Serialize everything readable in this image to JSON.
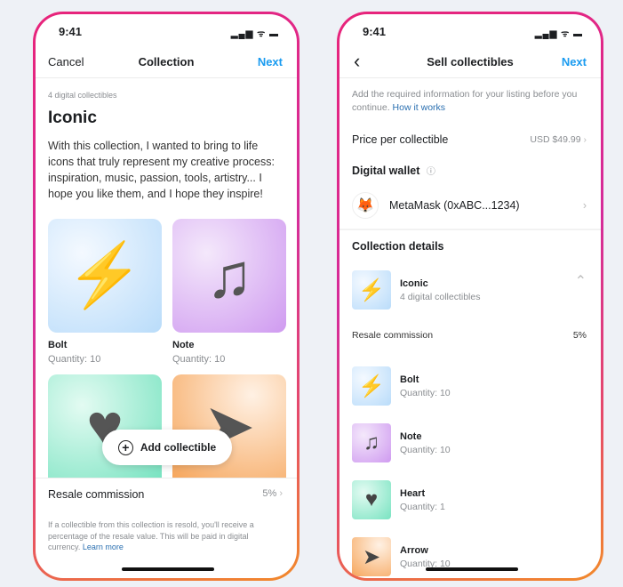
{
  "status": {
    "time": "9:41",
    "icons": "signal-wifi-battery"
  },
  "left": {
    "nav": {
      "cancel": "Cancel",
      "title": "Collection",
      "next": "Next"
    },
    "count": "4 digital collectibles",
    "name": "Iconic",
    "description": "With this collection, I wanted to bring to life icons that truly represent my creative process: inspiration, music, passion, tools, artistry... I hope you like them, and I hope they inspire!",
    "items": [
      {
        "name": "Bolt",
        "qty": "Quantity: 10",
        "icon": "⚡"
      },
      {
        "name": "Note",
        "qty": "Quantity: 10",
        "icon": "♫"
      },
      {
        "icon": "♥"
      },
      {
        "icon": "➤"
      }
    ],
    "add_button": "Add collectible",
    "resale": {
      "label": "Resale commission",
      "value": "5%"
    },
    "footnote": "If a collectible from this collection is resold, you'll receive a percentage of the resale value. This will be paid in digital currency.",
    "learn_more": "Learn more"
  },
  "right": {
    "nav": {
      "title": "Sell collectibles",
      "next": "Next"
    },
    "intro": "Add the required information for your listing before you continue.",
    "how_it_works": "How it works",
    "price": {
      "label": "Price per collectible",
      "value": "USD $49.99"
    },
    "wallet_heading": "Digital wallet",
    "wallet": "MetaMask (0xABC...1234)",
    "details_heading": "Collection details",
    "collection": {
      "name": "Iconic",
      "count": "4 digital collectibles"
    },
    "resale": {
      "label": "Resale commission",
      "value": "5%"
    },
    "items": [
      {
        "name": "Bolt",
        "qty": "Quantity: 10",
        "icon": "⚡"
      },
      {
        "name": "Note",
        "qty": "Quantity: 10",
        "icon": "♫"
      },
      {
        "name": "Heart",
        "qty": "Quantity: 1",
        "icon": "♥"
      },
      {
        "name": "Arrow",
        "qty": "Quantity: 10",
        "icon": "➤"
      }
    ]
  },
  "colors": {
    "accent": "#1a9bf0",
    "link": "#2a6fb0",
    "frame_start": "#e8247a",
    "frame_end": "#f28a2a"
  }
}
